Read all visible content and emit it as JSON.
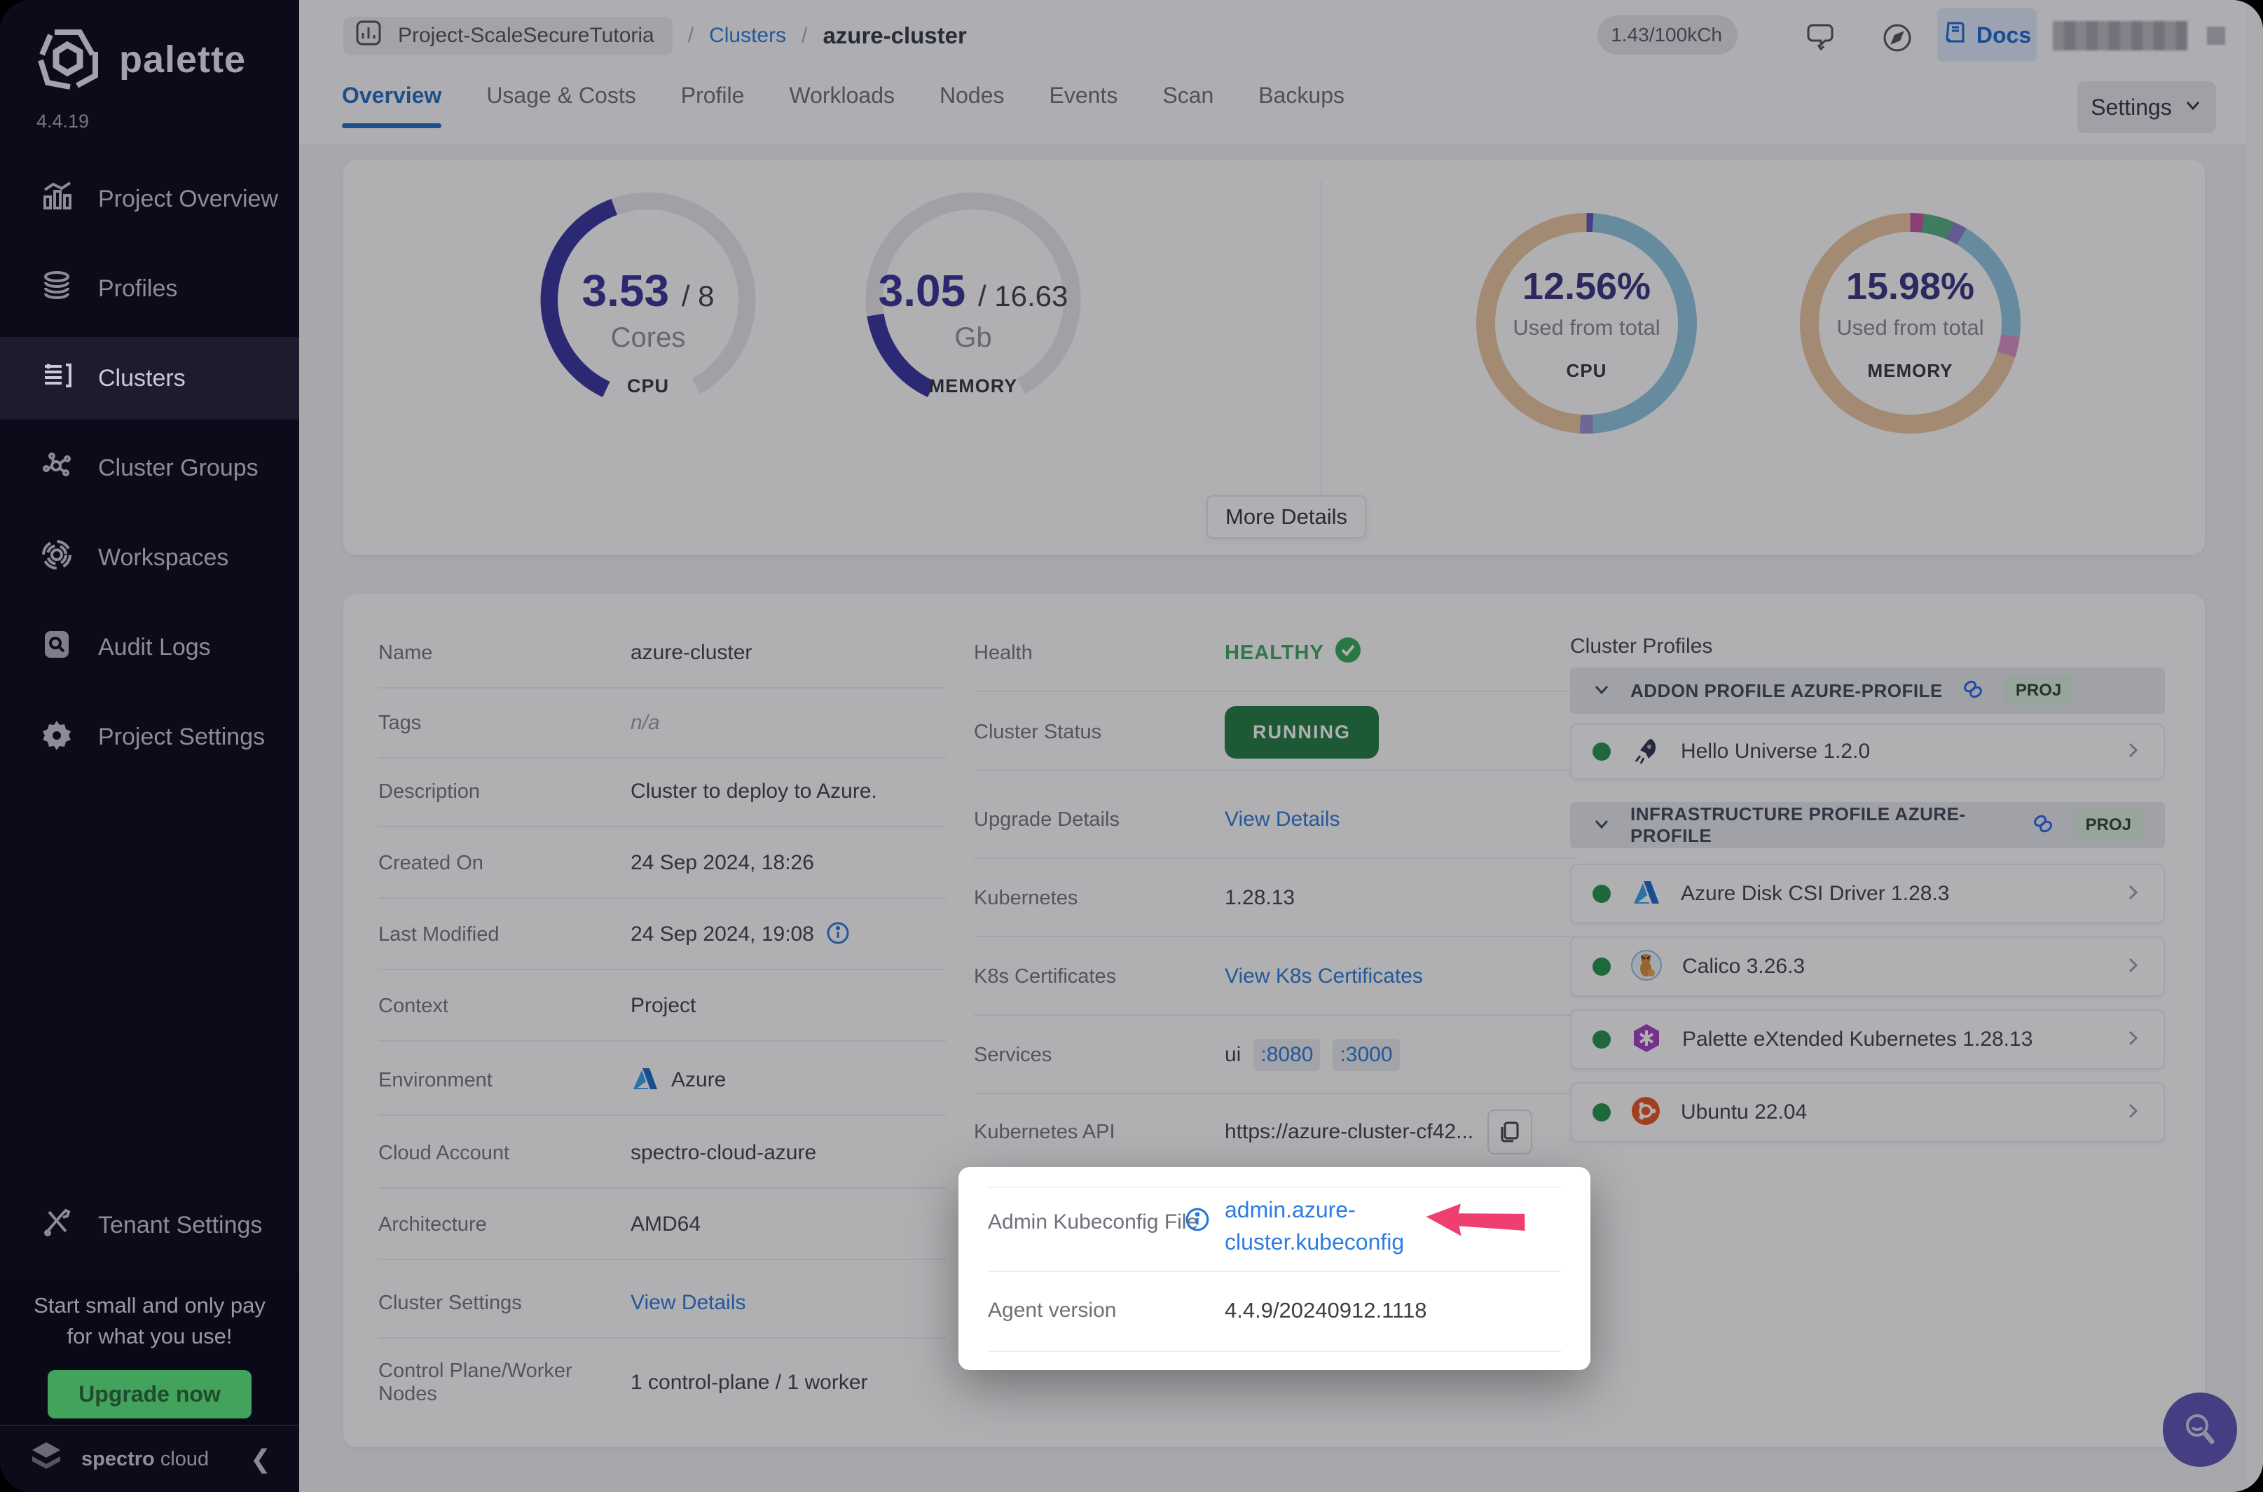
{
  "colors": {
    "accent_blue": "#2878d8",
    "docs_blue": "#1a66d0",
    "active_tab": "#1e6cc0",
    "healthy_green": "#3ca65c",
    "running_green": "#1d7a3c",
    "gauge_indigo": "#35309f",
    "donut_tan": "#ecc79d",
    "donut_blue": "#8fc6df",
    "donut_green": "#53b07e",
    "donut_magenta": "#c8529f",
    "donut_purple": "#8a7ccc",
    "donut_pink": "#dd8fc3",
    "arrow_pink": "#ef3f70",
    "upgrade_green": "#43a35d",
    "sidebar_bg": "#0d0b1a"
  },
  "app": {
    "brand": "palette",
    "version": "4.4.19",
    "footer_brand_bold": "spectro",
    "footer_brand_light": "cloud"
  },
  "sidebar": {
    "items": [
      {
        "label": "Project Overview"
      },
      {
        "label": "Profiles"
      },
      {
        "label": "Clusters"
      },
      {
        "label": "Cluster Groups"
      },
      {
        "label": "Workspaces"
      },
      {
        "label": "Audit Logs"
      },
      {
        "label": "Project Settings"
      }
    ],
    "tenant": "Tenant Settings",
    "upsell_line1": "Start small and only pay",
    "upsell_line2": "for what you use!",
    "upgrade": "Upgrade now"
  },
  "header": {
    "project": "Project-ScaleSecureTutoria",
    "sep": "/",
    "clusters_link": "Clusters",
    "cluster_name": "azure-cluster",
    "usage": "1.43/100kCh",
    "docs": "Docs"
  },
  "tabs": {
    "items": [
      {
        "label": "Overview"
      },
      {
        "label": "Usage & Costs"
      },
      {
        "label": "Profile"
      },
      {
        "label": "Workloads"
      },
      {
        "label": "Nodes"
      },
      {
        "label": "Events"
      },
      {
        "label": "Scan"
      },
      {
        "label": "Backups"
      }
    ],
    "settings": "Settings"
  },
  "gauges": {
    "cpu": {
      "value": "3.53",
      "total": "/ 8",
      "unit": "Cores",
      "caption": "CPU",
      "fraction": 0.441
    },
    "memory": {
      "value": "3.05",
      "total": "/ 16.63",
      "unit": "Gb",
      "caption": "MEMORY",
      "fraction": 0.183
    },
    "more_details": "More Details"
  },
  "donuts": {
    "cpu": {
      "pct": "12.56%",
      "sub": "Used from total",
      "caption": "CPU",
      "segments": [
        {
          "color": "#5a54b8",
          "to": 1
        },
        {
          "color": "#8fc6df",
          "to": 49
        },
        {
          "color": "#9b8fd0",
          "to": 51
        },
        {
          "color": "#ecc79d",
          "to": 100
        }
      ]
    },
    "memory": {
      "pct": "15.98%",
      "sub": "Used from total",
      "caption": "MEMORY",
      "segments": [
        {
          "color": "#c8529f",
          "to": 2
        },
        {
          "color": "#53b07e",
          "to": 6.5
        },
        {
          "color": "#8a7ccc",
          "to": 8.5
        },
        {
          "color": "#8fc6df",
          "to": 27
        },
        {
          "color": "#dd8fc3",
          "to": 30
        },
        {
          "color": "#ecc79d",
          "to": 100
        }
      ]
    }
  },
  "details": {
    "left": [
      {
        "label": "Name",
        "value": "azure-cluster"
      },
      {
        "label": "Tags",
        "value": "n/a"
      },
      {
        "label": "Description",
        "value": "Cluster to deploy to Azure."
      },
      {
        "label": "Created On",
        "value": "24 Sep 2024, 18:26"
      },
      {
        "label": "Last Modified",
        "value": "24 Sep 2024, 19:08"
      },
      {
        "label": "Context",
        "value": "Project"
      },
      {
        "label": "Environment",
        "value": "Azure"
      },
      {
        "label": "Cloud Account",
        "value": "spectro-cloud-azure"
      },
      {
        "label": "Architecture",
        "value": "AMD64"
      },
      {
        "label": "Cluster Settings",
        "value": "View Details"
      },
      {
        "label": "Control Plane/Worker Nodes",
        "value": "1 control-plane / 1 worker"
      }
    ],
    "right": {
      "health_label": "Health",
      "health_value": "HEALTHY",
      "status_label": "Cluster Status",
      "status_value": "RUNNING",
      "upgrade_label": "Upgrade Details",
      "upgrade_value": "View Details",
      "k8s_label": "Kubernetes",
      "k8s_value": "1.28.13",
      "certs_label": "K8s Certificates",
      "certs_value": "View K8s Certificates",
      "services_label": "Services",
      "services_name": "ui",
      "services_port1": ":8080",
      "services_port2": ":3000",
      "api_label": "Kubernetes API",
      "api_value": "https://azure-cluster-cf42..."
    }
  },
  "spotlight": {
    "kubeconfig_label": "Admin Kubeconfig File",
    "kubeconfig_link_line1": "admin.azure-",
    "kubeconfig_link_line2": "cluster.kubeconfig",
    "agent_label": "Agent version",
    "agent_value": "4.4.9/20240912.1118"
  },
  "profiles": {
    "title": "Cluster Profiles",
    "addon_header": "ADDON PROFILE AZURE-PROFILE",
    "addon_badge": "PROJ",
    "addon_items": [
      {
        "name": "Hello Universe 1.2.0"
      }
    ],
    "infra_header": "INFRASTRUCTURE PROFILE AZURE-PROFILE",
    "infra_badge": "PROJ",
    "infra_items": [
      {
        "name": "Azure Disk CSI Driver 1.28.3"
      },
      {
        "name": "Calico 3.26.3"
      },
      {
        "name": "Palette eXtended Kubernetes 1.28.13"
      },
      {
        "name": "Ubuntu 22.04"
      }
    ]
  }
}
